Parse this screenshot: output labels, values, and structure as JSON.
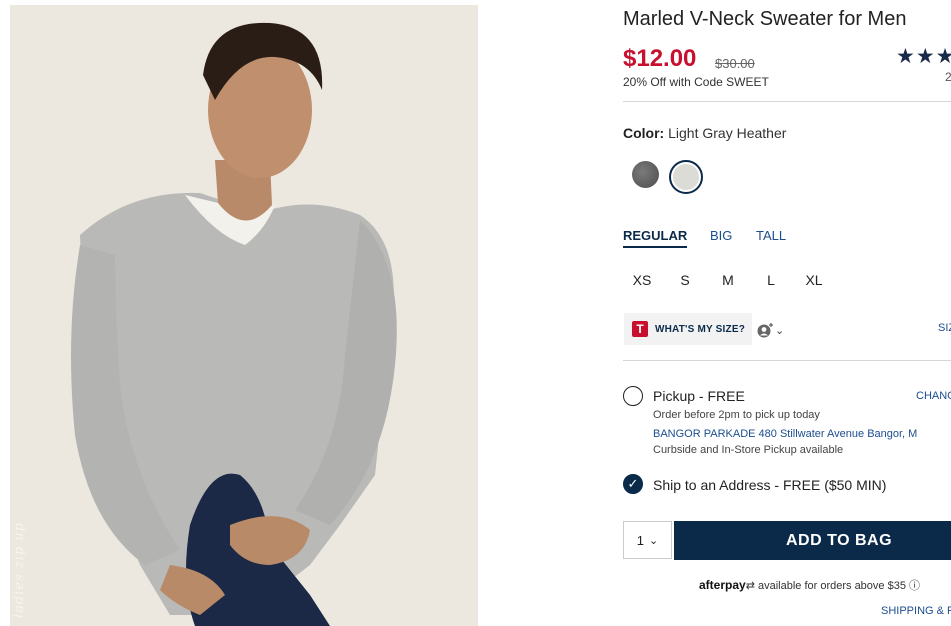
{
  "product": {
    "title": "Marled V-Neck Sweater for Men",
    "price": "$12.00",
    "original_price": "$30.00",
    "promo": "20% Off with Code SWEET",
    "rating_stars": "★★★",
    "review_count": "2",
    "image_watermark": "ladies zip up"
  },
  "color": {
    "label": "Color:",
    "selected": "Light Gray Heather",
    "swatches": [
      {
        "name": "charcoal",
        "hex": "#5a5a5a"
      },
      {
        "name": "light-gray-heather",
        "hex": "#dcdcd6",
        "selected": true
      }
    ]
  },
  "fit": {
    "tabs": [
      "REGULAR",
      "BIG",
      "TALL"
    ],
    "active": "REGULAR"
  },
  "sizes": [
    "XS",
    "S",
    "M",
    "L",
    "XL"
  ],
  "size_help": {
    "logo": "T",
    "label": "WHAT'S MY SIZE?",
    "user_icon": "user-plus-icon",
    "chevron": "⌄",
    "size_chart_label": "SIZ"
  },
  "fulfillment": {
    "pickup_label": "Pickup - FREE",
    "change_label": "CHANG",
    "pickup_note": "Order before 2pm to pick up today",
    "store": "BANGOR PARKADE 480 Stillwater Avenue  Bangor, M",
    "curbside": "Curbside and In-Store Pickup available",
    "ship_label": "Ship to an Address - FREE ($50 MIN)"
  },
  "cart": {
    "quantity": "1",
    "quantity_chevron": "⌄",
    "add_to_bag": "ADD TO BAG"
  },
  "afterpay": {
    "brand": "afterpay",
    "text": " available for orders above $35 ⓘ"
  },
  "shipping_link": "SHIPPING & R",
  "colors": {
    "navy": "#0b2a4a",
    "sale_red": "#c8102e",
    "link_blue": "#1c4e8f"
  }
}
